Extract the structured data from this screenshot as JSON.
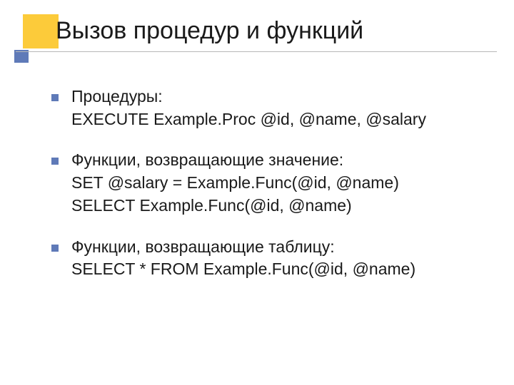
{
  "title": "Вызов процедур и функций",
  "items": [
    {
      "lines": [
        "Процедуры:",
        "EXECUTE Example.Proc @id, @name, @salary"
      ]
    },
    {
      "lines": [
        "Функции, возвращающие значение:",
        "SET @salary = Example.Func(@id, @name)",
        "SELECT Example.Func(@id, @name)"
      ]
    },
    {
      "lines": [
        "Функции, возвращающие таблицу:",
        "SELECT * FROM Example.Func(@id, @name)"
      ]
    }
  ]
}
